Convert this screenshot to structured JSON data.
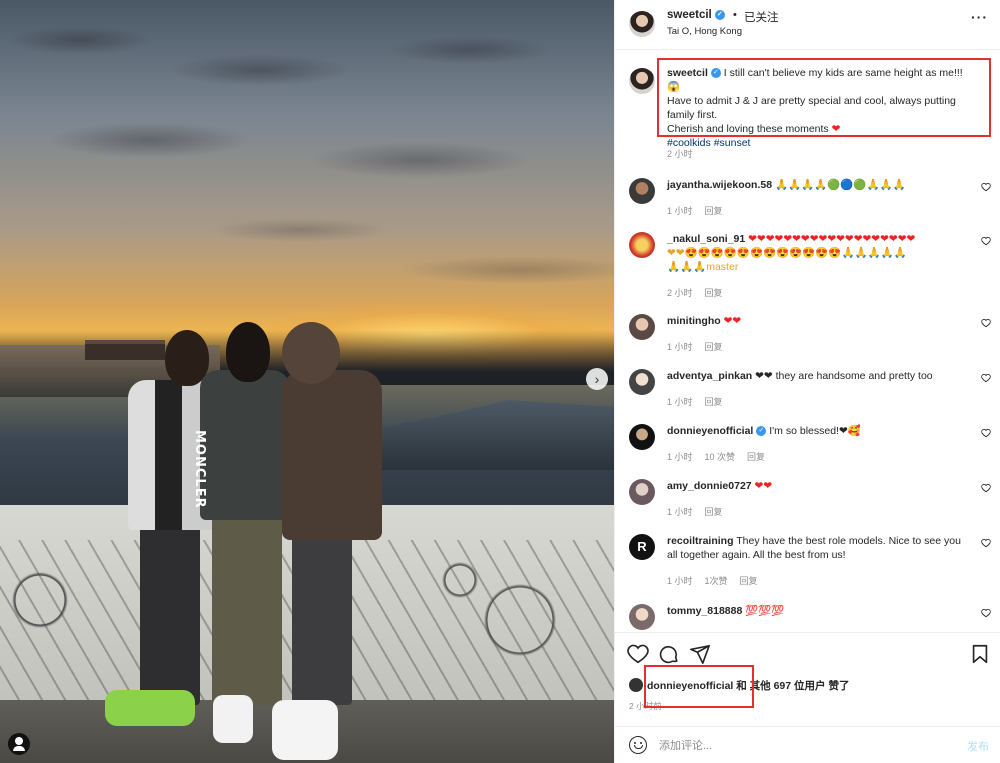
{
  "photo": {
    "alt": "",
    "moncler_text": "MONCLER"
  },
  "header": {
    "username": "sweetcil",
    "separator": "•",
    "follow_status": "已关注",
    "location": "Tai O, Hong Kong",
    "more": "···"
  },
  "caption": {
    "username": "sweetcil",
    "line1": " I still can't believe my kids are same height as me!!! 😱",
    "line2": "Have to admit J & J are pretty special and cool, always putting",
    "line3": "family first.",
    "line4": "Cherish and loving these moments ",
    "heart": "❤",
    "hashtags": "#coolkids #sunset",
    "time": "2 小时"
  },
  "comments": [
    {
      "user": "jayantha.wijekoon.58",
      "text": " 🙏🙏🙏🙏🟢🔵🟢🙏🙏🙏",
      "time": "1 小时",
      "reply": "回复"
    },
    {
      "user": "_nakul_soni_91",
      "text_line1": " ❤❤❤❤❤❤❤❤❤❤❤❤❤❤❤❤❤❤❤",
      "text_line2": "❤❤😍😍😍😍😍😍😍😍😍😍😍😍🙏🙏🙏🙏🙏",
      "text_line3": "🙏🙏🙏master",
      "time": "2 小时",
      "reply": "回复"
    },
    {
      "user": "minitingho",
      "text": " ❤❤",
      "time": "1 小时",
      "reply": "回复"
    },
    {
      "user": "adventya_pinkan",
      "text": " ❤❤ they are handsome and pretty too",
      "time": "1 小时",
      "reply": "回复"
    },
    {
      "user": "donnieyenofficial",
      "text": " I'm so blessed!❤🥰",
      "time": "1 小时",
      "likes": "10 次赞",
      "reply": "回复"
    },
    {
      "user": "amy_donnie0727",
      "text": " ❤❤",
      "time": "1 小时",
      "reply": "回复"
    },
    {
      "user": "recoiltraining",
      "text": " They have the best role models. Nice to see you all together again. All the best from us!",
      "time": "1 小时",
      "likes": "1次赞",
      "reply": "回复"
    },
    {
      "user": "tommy_818888",
      "text": " 💯💯💯"
    }
  ],
  "likes": {
    "user": "donnieyenofficial",
    "rest": " 和 其他 697 位用户 赞了"
  },
  "time_ago": "2 小时前",
  "add_comment": {
    "placeholder": "添加评论...",
    "post_label": "发布"
  },
  "colors": {
    "verified": "#3897f0",
    "like_red": "#ed2224",
    "highlight_box": "#e03030",
    "link_blue": "#00376b"
  }
}
